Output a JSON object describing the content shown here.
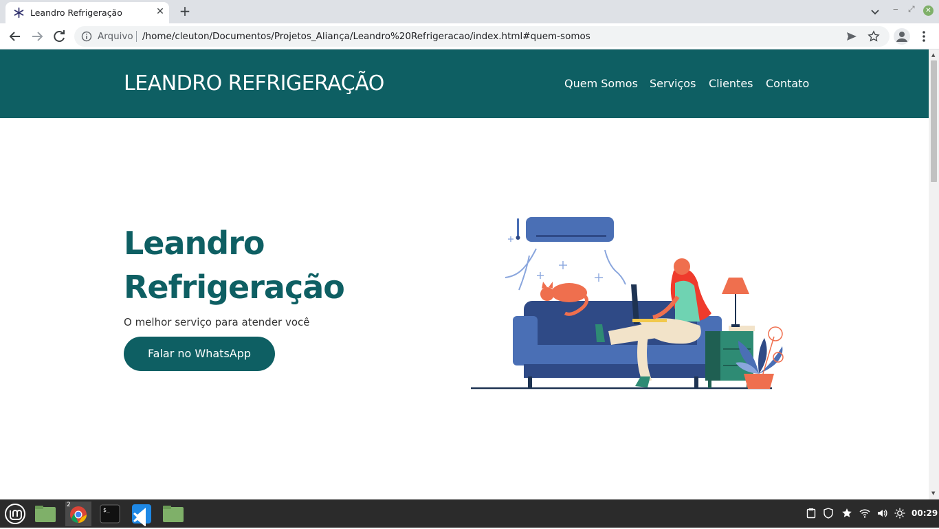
{
  "browser": {
    "tab_title": "Leandro Refrigeração",
    "tab_close": "✕",
    "new_tab": "+",
    "omnibox_label": "Arquivo",
    "url": "/home/cleuton/Documentos/Projetos_Aliança/Leandro%20Refrigeracao/index.html#quem-somos"
  },
  "site": {
    "brand": "LEANDRO REFRIGERAÇÃO",
    "nav": [
      "Quem Somos",
      "Serviços",
      "Clientes",
      "Contato"
    ],
    "hero_title": "Leandro Refrigeração",
    "hero_subtitle": "O melhor serviço para atender você",
    "cta_label": "Falar no WhatsApp"
  },
  "taskbar": {
    "chrome_badge": "2",
    "clock": "00:29"
  },
  "colors": {
    "primary": "#0e5f63",
    "sofa": "#4a6fb5",
    "accent": "#ef6f4e"
  }
}
